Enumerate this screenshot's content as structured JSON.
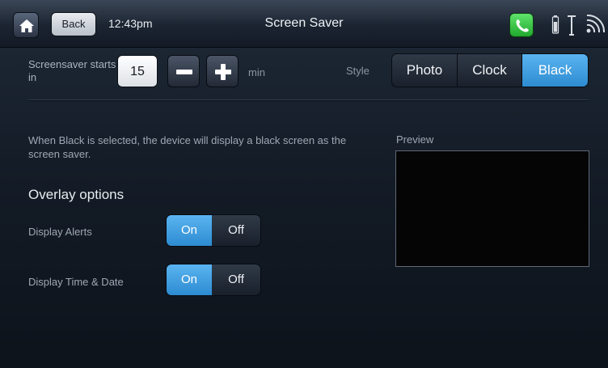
{
  "header": {
    "back_label": "Back",
    "time": "12:43pm",
    "title": "Screen Saver",
    "icons": [
      "home-icon",
      "phone-icon",
      "battery-icon",
      "antenna-icon",
      "wifi-icon"
    ]
  },
  "settings": {
    "starts_label": "Screensaver starts in",
    "minutes_value": "15",
    "unit": "min",
    "style_label": "Style",
    "style_options": [
      "Photo",
      "Clock",
      "Black"
    ],
    "style_selected": "Black"
  },
  "description": "When Black is selected, the device will display a black screen as the screen saver.",
  "overlay": {
    "heading": "Overlay options",
    "rows": [
      {
        "label": "Display Alerts",
        "on_label": "On",
        "off_label": "Off",
        "state": "On"
      },
      {
        "label": "Display Time & Date",
        "on_label": "On",
        "off_label": "Off",
        "state": "On"
      }
    ]
  },
  "preview": {
    "label": "Preview"
  },
  "colors": {
    "accent": "#3a9be0",
    "background": "#141c27"
  }
}
